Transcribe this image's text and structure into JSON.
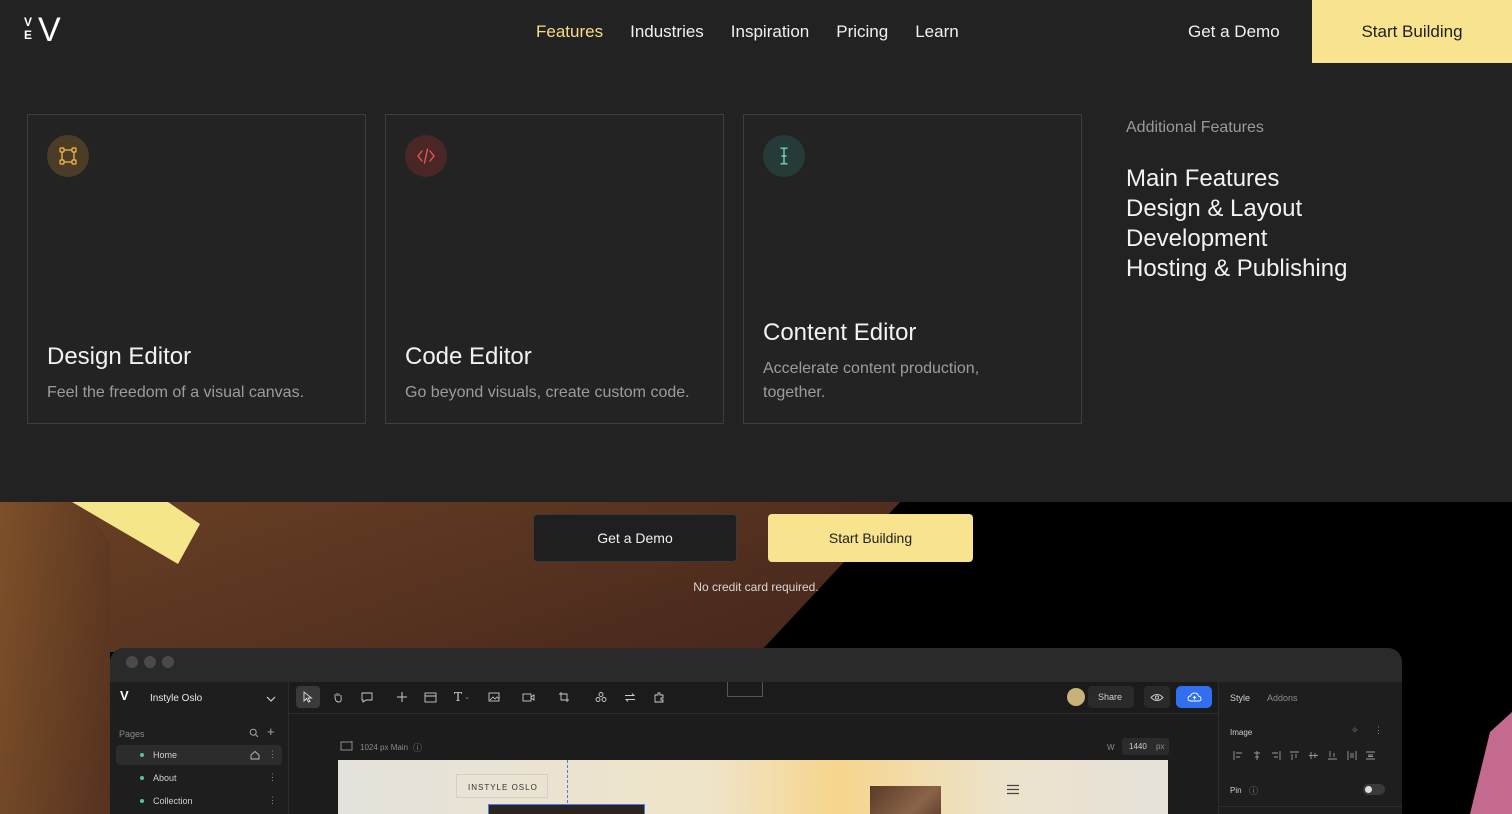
{
  "header": {
    "logo_small": "VE",
    "logo_big": "V",
    "nav": [
      {
        "label": "Features",
        "active": true
      },
      {
        "label": "Industries",
        "active": false
      },
      {
        "label": "Inspiration",
        "active": false
      },
      {
        "label": "Pricing",
        "active": false
      },
      {
        "label": "Learn",
        "active": false
      }
    ],
    "demo_label": "Get a Demo",
    "start_label": "Start Building"
  },
  "mega_menu": {
    "cards": [
      {
        "title": "Design Editor",
        "desc": "Feel the freedom of a visual canvas.",
        "icon": "frame-nodes-icon",
        "icon_color": "#e6b04a",
        "icon_bg": "#4a3c26"
      },
      {
        "title": "Code Editor",
        "desc": "Go beyond visuals, create custom code.",
        "icon": "code-brackets-icon",
        "icon_color": "#e4584f",
        "icon_bg": "#4a2626"
      },
      {
        "title": "Content Editor",
        "desc": "Accelerate content production, together.",
        "icon": "text-cursor-icon",
        "icon_color": "#6fd0c2",
        "icon_bg": "#263a38"
      }
    ],
    "additional_heading": "Additional Features",
    "additional_items": [
      "Main Features",
      "Design & Layout",
      "Development",
      "Hosting & Publishing"
    ]
  },
  "hero": {
    "demo_label": "Get a Demo",
    "start_label": "Start Building",
    "note": "No credit card required."
  },
  "app_mock": {
    "project_name": "Instyle Oslo",
    "pages_label": "Pages",
    "pages": [
      "Home",
      "About",
      "Collection"
    ],
    "breakpoint_label": "1024 px Main",
    "width_label": "W",
    "width_value": "1440",
    "width_unit": "px",
    "share_label": "Share",
    "style_tab": "Style",
    "addons_tab": "Addons",
    "image_label": "Image",
    "pin_label": "Pin",
    "site_title": "INSTYLE OSLO"
  },
  "colors": {
    "accent_yellow": "#f8e38f",
    "active_nav": "#f6de86",
    "publish_blue": "#2f6ff0"
  }
}
